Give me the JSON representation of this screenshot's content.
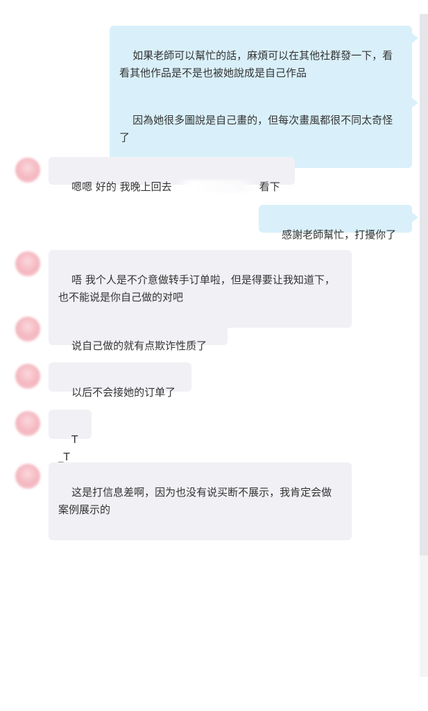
{
  "messages": [
    {
      "from": "self",
      "text": "如果老師可以幫忙的話，麻煩可以在其他社群發一下，看看其他作品是不是也被她說成是自己作品"
    },
    {
      "from": "self",
      "text": "因為她很多圖說是自己畫的，但每次畫風都很不同太奇怪了"
    },
    {
      "from": "other",
      "text_before": "嗯嗯 好的 我晚上回去",
      "text_after": "看下"
    },
    {
      "from": "self",
      "text": "感謝老師幫忙，打擾你了"
    },
    {
      "from": "other",
      "text": "唔 我个人是不介意做转手订单啦，但是得要让我知道下，也不能说是你自己做的对吧"
    },
    {
      "from": "other",
      "text": "说自己做的就有点欺诈性质了"
    },
    {
      "from": "other",
      "text": "以后不会接她的订单了"
    },
    {
      "from": "other",
      "text": "T_T"
    },
    {
      "from": "other",
      "text": "这是打信息差啊，因为也没有说买断不展示，我肯定会做案例展示的"
    }
  ]
}
